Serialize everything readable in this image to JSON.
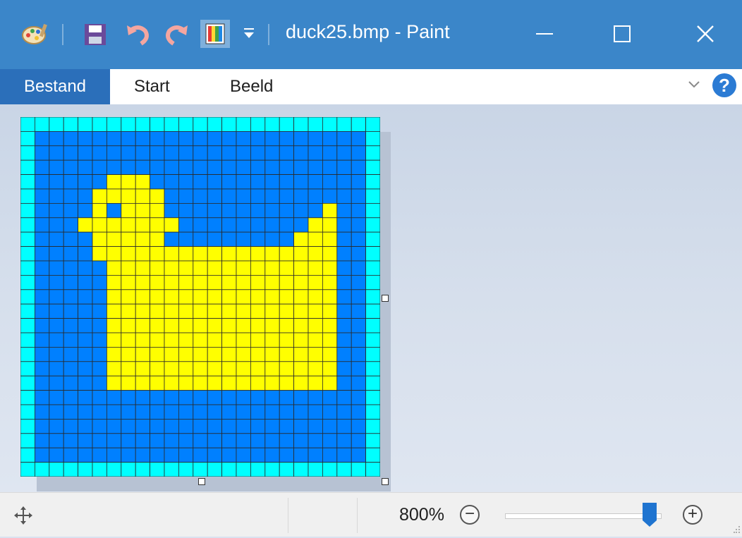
{
  "window": {
    "title": "duck25.bmp - Paint"
  },
  "menu": {
    "items": [
      "Bestand",
      "Start",
      "Beeld"
    ]
  },
  "help": {
    "label": "?"
  },
  "statusbar": {
    "zoom_label": "800%",
    "zoom_fraction": 0.93
  },
  "icons": {
    "app": "paint-palette-icon",
    "save": "save-icon",
    "undo": "undo-icon",
    "redo": "redo-icon",
    "colors": "edit-colors-icon",
    "customize": "customize-dropdown-icon",
    "minimize": "minimize-icon",
    "maximize": "maximize-icon",
    "close": "close-icon",
    "ribbon_toggle": "chevron-down-icon",
    "move": "move-cursor-icon",
    "zoom_out": "zoom-out-icon",
    "zoom_in": "zoom-in-icon"
  },
  "colors": {
    "titlebar": "#3b86c9",
    "menu_active": "#2b6fba",
    "pixel_border": "#00ffff",
    "pixel_water": "#0080ff",
    "pixel_duck": "#ffff00"
  },
  "image": {
    "size": 25,
    "pixels": [
      "BBBBBBBBBBBBBBBBBBBBBBBBB",
      "BWWWWWWWWWWWWWWWWWWWWWWWB",
      "BWWWWWWWWWWWWWWWWWWWWWWWB",
      "BWWWWWWWWWWWWWWWWWWWWWWWB",
      "BWWWWWYYYWWWWWWWWWWWWWWWB",
      "BWWWWYYYYYWWWWWWWWWWWWWWB",
      "BWWWWYWYYYWWWWWWWWWWWYWWB",
      "BWWWYYYYYYYWWWWWWWWWYYWWB",
      "BWWWWYYYYYWWWWWWWWWYYYWWB",
      "BWWWWYYYYYYYYYYYYYYYYYWWB",
      "BWWWWWYYYYYYYYYYYYYYYYWWB",
      "BWWWWWYYYYYYYYYYYYYYYYWWB",
      "BWWWWWYYYYYYYYYYYYYYYYWWB",
      "BWWWWWYYYYYYYYYYYYYYYYWWB",
      "BWWWWWYYYYYYYYYYYYYYYYWWB",
      "BWWWWWYYYYYYYYYYYYYYYYWWB",
      "BWWWWWYYYYYYYYYYYYYYYYWWB",
      "BWWWWWYYYYYYYYYYYYYYYYWWB",
      "BWWWWWYYYYYYYYYYYYYYYYWWB",
      "BWWWWWWWWWWWWWWWWWWWWWWWB",
      "BWWWWWWWWWWWWWWWWWWWWWWWB",
      "BWWWWWWWWWWWWWWWWWWWWWWWB",
      "BWWWWWWWWWWWWWWWWWWWWWWWB",
      "BWWWWWWWWWWWWWWWWWWWWWWWB",
      "BBBBBBBBBBBBBBBBBBBBBBBBB"
    ]
  }
}
